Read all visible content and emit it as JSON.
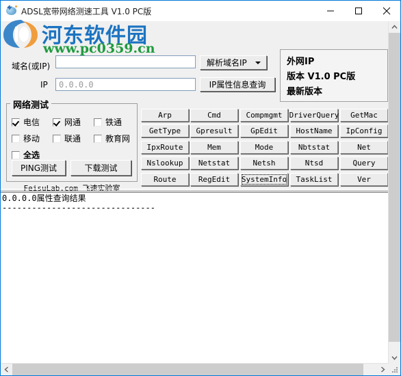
{
  "window": {
    "title": "ADSL宽带网络测速工具 V1.0 PC版",
    "icon": "adsl-globe-icon",
    "controls": {
      "minimize": "minimize-icon",
      "maximize": "maximize-icon",
      "close": "close-icon"
    }
  },
  "watermark": {
    "text_cn": "河东软件园",
    "url": "www.pc0359.cn",
    "color_cn": "#1b73c1",
    "color_url": "#1f9b3e"
  },
  "form": {
    "domain_label": "域名(或IP)",
    "domain_value": "",
    "domain_placeholder": "",
    "ip_label": "IP",
    "ip_value": "0.0.0.0",
    "resolve_button": "解析域名IP",
    "ip_query_button": "IP属性信息查询"
  },
  "info_panel": {
    "wan_ip": "外网IP",
    "version": "版本 V1.0 PC版",
    "latest": "最新版本"
  },
  "network_test": {
    "title": "网络测试",
    "checkboxes": [
      {
        "label": "电信",
        "checked": true,
        "bold": false
      },
      {
        "label": "网通",
        "checked": true,
        "bold": false
      },
      {
        "label": "铁通",
        "checked": false,
        "bold": false
      },
      {
        "label": "移动",
        "checked": false,
        "bold": false
      },
      {
        "label": "联通",
        "checked": false,
        "bold": false
      },
      {
        "label": "教育网",
        "checked": false,
        "bold": false
      },
      {
        "label": "全选",
        "checked": false,
        "bold": true
      }
    ],
    "ping_button": "PING测试",
    "download_button": "下载测试",
    "footer": "FeisuLab.com 飞速实验室"
  },
  "command_grid": {
    "rows": [
      [
        "Arp",
        "Cmd",
        "Compmgmt",
        "DriverQuery",
        "GetMac"
      ],
      [
        "GetType",
        "Gpresult",
        "GpEdit",
        "HostName",
        "IpConfig"
      ],
      [
        "IpxRoute",
        "Mem",
        "Mode",
        "Nbtstat",
        "Net"
      ],
      [
        "Nslookup",
        "Netstat",
        "Netsh",
        "Ntsd",
        "Query"
      ],
      [
        "Route",
        "RegEdit",
        "SystemInfo",
        "TaskList",
        "Ver"
      ]
    ],
    "focused_button": "SystemInfo"
  },
  "results": {
    "text": "0.0.0.0属性查询结果\n-------------------------------"
  },
  "scrollbars": {
    "vertical": {
      "up": "scroll-up-icon",
      "down": "scroll-down-icon"
    },
    "horizontal": {
      "left": "scroll-left-icon",
      "right": "scroll-right-icon"
    }
  }
}
